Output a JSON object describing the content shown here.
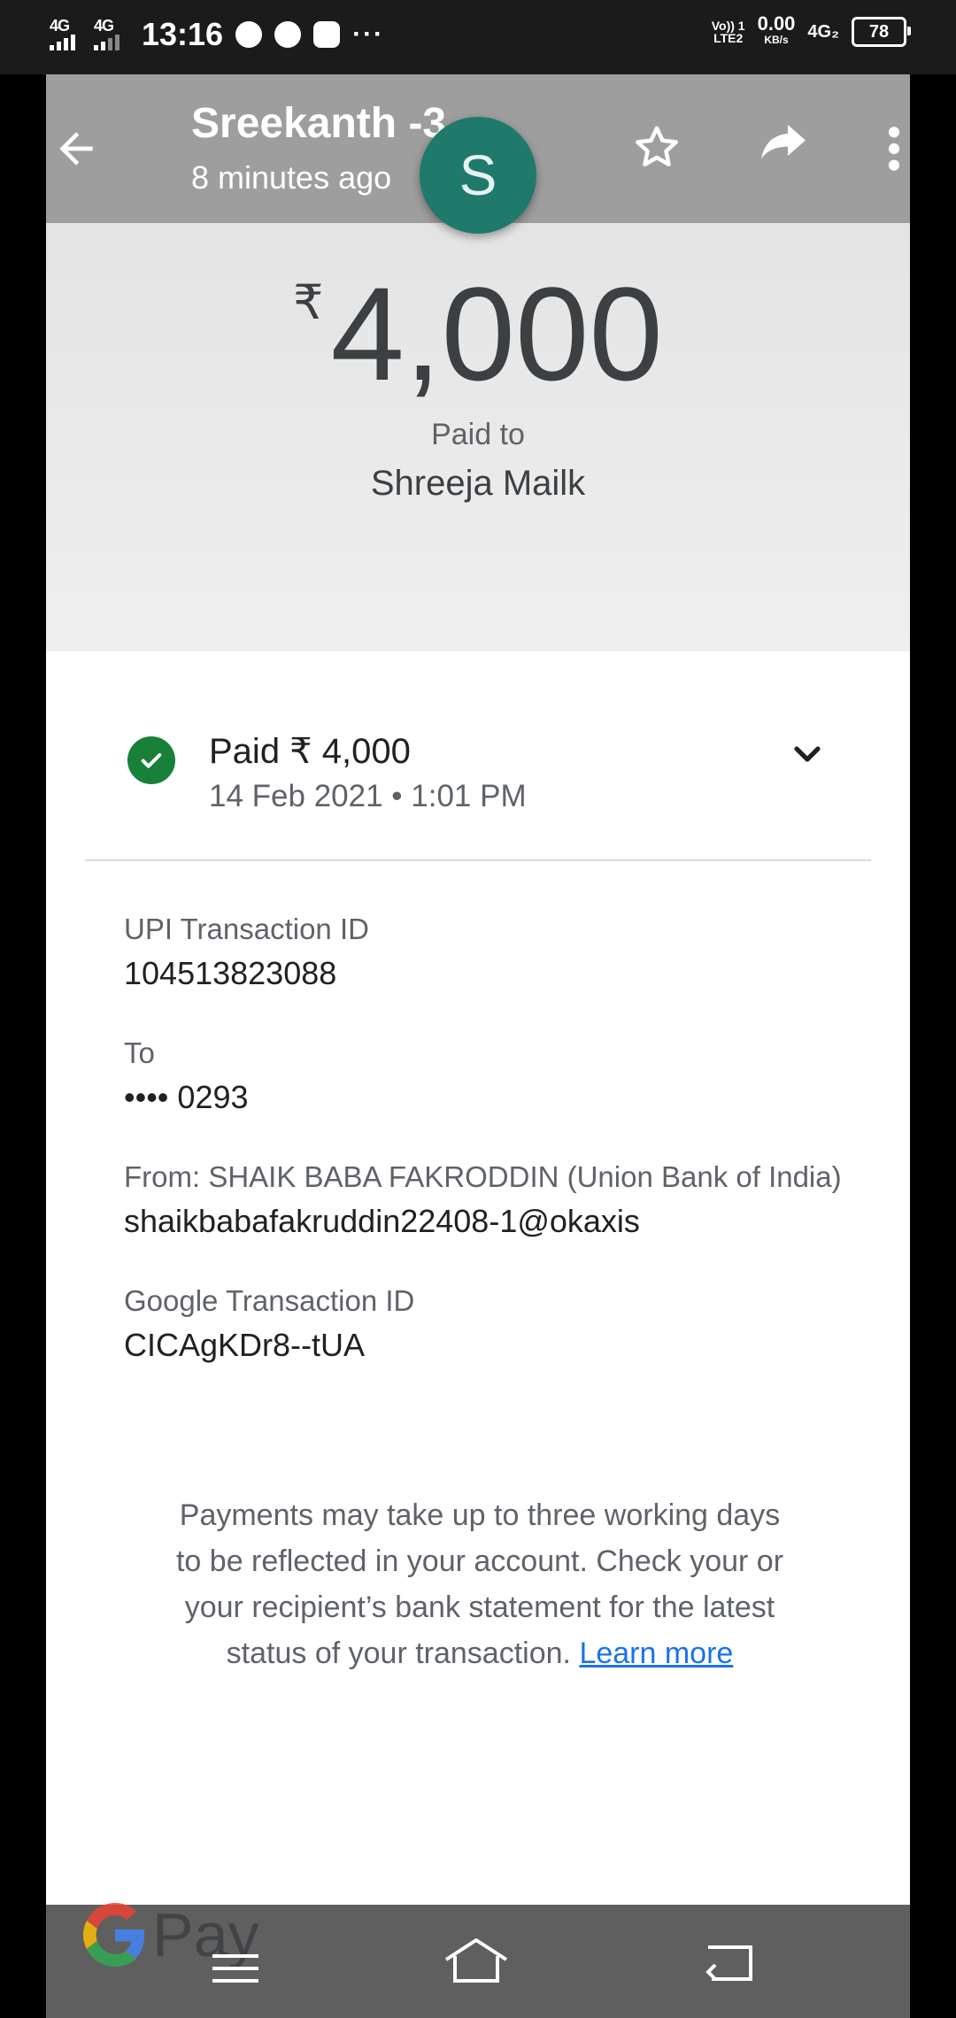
{
  "statusbar": {
    "sim1": "4G",
    "sim2": "4G",
    "time": "13:16",
    "volte_top": "Vo)) 1",
    "volte_bottom": "LTE2",
    "speed_value": "0.00",
    "speed_unit": "KB/s",
    "network": "4G₂",
    "battery": "78"
  },
  "header": {
    "title": "Sreekanth -3",
    "subtitle": "8 minutes ago",
    "avatar_letter": "S"
  },
  "payment": {
    "currency_symbol": "₹",
    "amount": "4,000",
    "paid_to_label": "Paid to",
    "payee": "Shreeja Mailk"
  },
  "status": {
    "label": "Paid ₹ 4,000",
    "datetime": "14 Feb 2021 • 1:01 PM",
    "color": "#188038"
  },
  "details": {
    "upi_label": "UPI Transaction ID",
    "upi_value": "104513823088",
    "to_label": "To",
    "to_value": "•••• 0293",
    "from_label": "From: SHAIK BABA FAKRODDIN (Union Bank of India)",
    "from_value": "shaikbabafakruddin22408-1@okaxis",
    "google_label": "Google Transaction ID",
    "google_value": "CICAgKDr8--tUA"
  },
  "note": {
    "text": "Payments may take up to three working days to be reflected in your account. Check your or your recipient’s bank statement for the latest status of your transaction.",
    "link": "Learn more"
  },
  "branding": {
    "pay_text": "Pay"
  },
  "colors": {
    "accent_link": "#1a73e8",
    "avatar": "#1f7a6b",
    "header_bg": "#9e9e9e"
  }
}
